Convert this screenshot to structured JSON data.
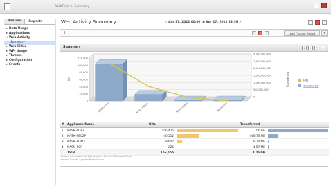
{
  "window": {
    "breadcrumb": "WebFilter > Summary"
  },
  "sidebar": {
    "tabs": [
      {
        "label": "Policies"
      },
      {
        "label": "Reports"
      }
    ],
    "items": [
      {
        "label": "Data Usage"
      },
      {
        "label": "Applications"
      },
      {
        "label": "Web Activity"
      },
      {
        "label": "Summary"
      },
      {
        "label": "Web Filter"
      },
      {
        "label": "WPI Usage"
      },
      {
        "label": "Threats"
      },
      {
        "label": "Configuration"
      },
      {
        "label": "Events"
      }
    ]
  },
  "report": {
    "title": "Web Activity Summary",
    "date_range": "Apr 17, 2012 00:00 to Apr 17, 2012 23:59",
    "prev_symbol": "<",
    "next_symbol": ">",
    "load_button": "Load Custom Report",
    "add_filter_symbol": "+"
  },
  "panel": {
    "title": "Summary"
  },
  "chart_data": {
    "type": "bar",
    "categories": [
      "NASM-PDP3",
      "NASM-PB02P",
      "NASM-PDM3",
      "NASM-PCP"
    ],
    "series": [
      {
        "name": "Hits",
        "type": "line",
        "axis": "left",
        "values": [
          106475,
          40512,
          9642,
          226
        ]
      },
      {
        "name": "Transferred",
        "type": "bar",
        "axis": "right",
        "values": [
          2.6,
          0.44676,
          0.00614,
          0.00457
        ]
      }
    ],
    "ylabel": "Hits",
    "y2label": "Transferred",
    "ylim": [
      0,
      120000
    ],
    "yticks": [
      "0",
      "20,000",
      "40,000",
      "60,000",
      "80,000",
      "100,000",
      "120,000"
    ],
    "y2lim": [
      0,
      3
    ],
    "y2ticks": [
      "0",
      "500,000,000",
      "1,000,000,000",
      "1,500,000,000",
      "2,000,000,000",
      "2,500,000,000",
      "3,000,000,000"
    ],
    "colors": {
      "hits": "#d6c84a",
      "transferred": "#8fa9c8"
    },
    "legend": "right",
    "grid": true
  },
  "table": {
    "columns": [
      "#",
      "Appliance Name",
      "Hits",
      "Transferred"
    ],
    "rows": [
      {
        "index": "1",
        "name": "NASM-PDP3",
        "hits": "106,475",
        "transferred": "2.6 GB",
        "hits_frac": 1.0,
        "tx_frac": 1.0
      },
      {
        "index": "2",
        "name": "NASM-PB02P",
        "hits": "40,512",
        "transferred": "446.76 MB",
        "hits_frac": 0.38,
        "tx_frac": 0.17
      },
      {
        "index": "3",
        "name": "NASM-PDM3",
        "hits": "9,642",
        "transferred": "6.14 MB",
        "hits_frac": 0.09,
        "tx_frac": 0.01
      },
      {
        "index": "4",
        "name": "NASM-PCP",
        "hits": "226",
        "transferred": "4.57 MB",
        "hits_frac": 0.01,
        "tx_frac": 0.01
      }
    ],
    "total_label": "Total",
    "total_hits": "156,155",
    "total_transferred": "3.05 GB"
  },
  "notes": [
    "Report generated for Netsweeper Central Standard Time",
    "Report Scope: SystemWide\\Sbuser"
  ]
}
